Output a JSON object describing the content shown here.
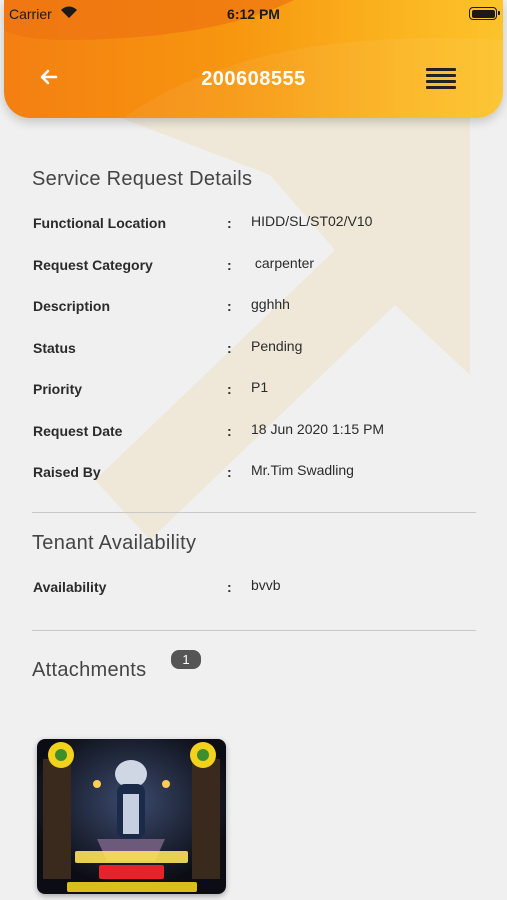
{
  "status_bar": {
    "carrier": "Carrier",
    "time": "6:12 PM"
  },
  "header": {
    "title": "200608555"
  },
  "service_request": {
    "title": "Service Request Details",
    "rows": [
      {
        "label": "Functional Location",
        "value": "HIDD/SL/ST02/V10"
      },
      {
        "label": "Request Category",
        "value": " carpenter"
      },
      {
        "label": "Description",
        "value": "gghhh"
      },
      {
        "label": "Status",
        "value": "Pending"
      },
      {
        "label": "Priority",
        "value": "P1"
      },
      {
        "label": "Request Date",
        "value": "18 Jun 2020 1:15 PM"
      },
      {
        "label": "Raised By",
        "value": "Mr.Tim Swadling"
      }
    ]
  },
  "tenant": {
    "title": "Tenant Availability",
    "rows": [
      {
        "label": "Availability",
        "value": "bvvb"
      }
    ]
  },
  "attachments": {
    "title": "Attachments",
    "count": "1",
    "thumbnail_icon": "image-thumbnail"
  },
  "colors": {
    "header_start": "#f47f12",
    "header_end": "#fcc32a",
    "background": "#f0f0f0"
  }
}
